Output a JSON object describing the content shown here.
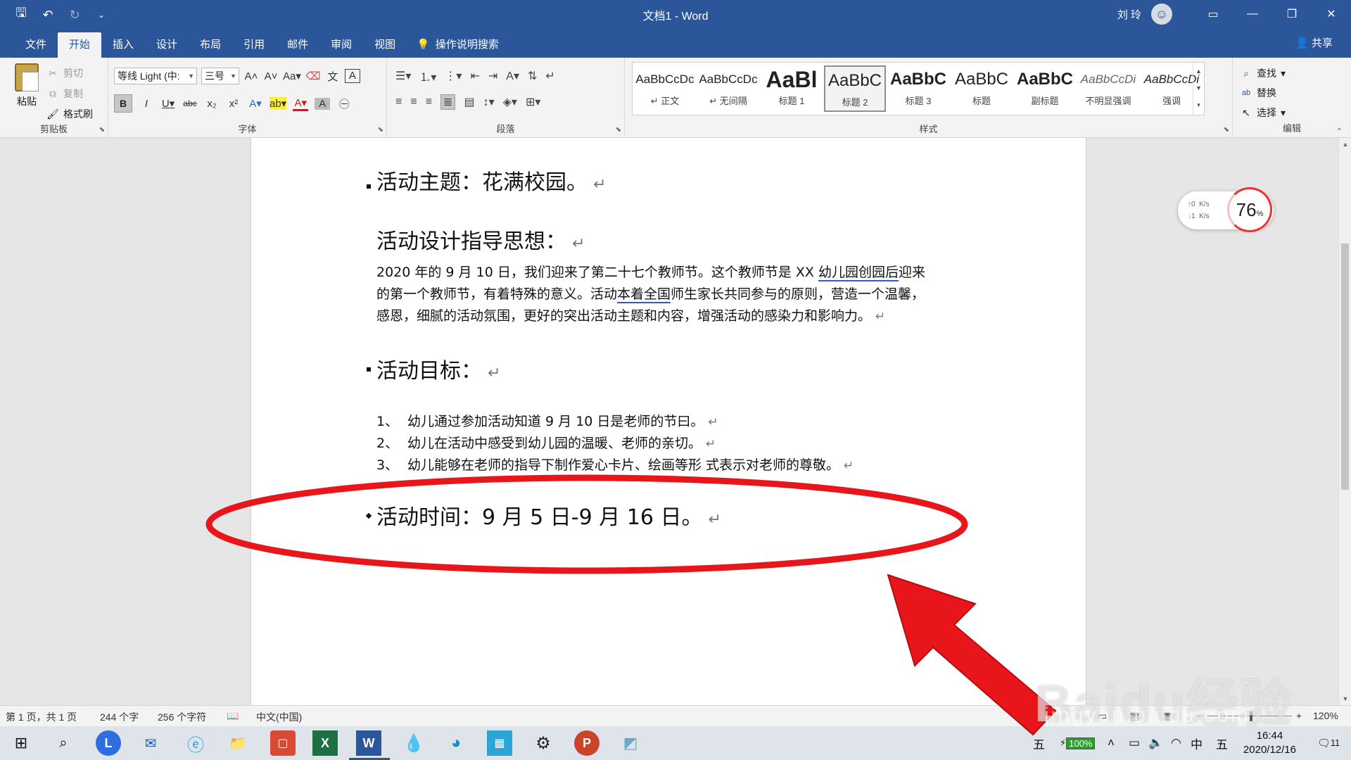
{
  "window": {
    "title": "文档1 - Word",
    "user": "刘 玲",
    "colors": {
      "accent": "#2b579a",
      "annotation": "#e8151b"
    }
  },
  "qat": {
    "save_icon": "save-icon",
    "undo_icon": "undo-icon",
    "redo_icon": "redo-icon"
  },
  "tabs": [
    {
      "label": "文件"
    },
    {
      "label": "开始"
    },
    {
      "label": "插入"
    },
    {
      "label": "设计"
    },
    {
      "label": "布局"
    },
    {
      "label": "引用"
    },
    {
      "label": "邮件"
    },
    {
      "label": "审阅"
    },
    {
      "label": "视图"
    }
  ],
  "tell_me": "操作说明搜索",
  "share": "共享",
  "clipboard": {
    "paste": "粘贴",
    "cut": "剪切",
    "copy": "复制",
    "format_painter": "格式刷",
    "group": "剪贴板"
  },
  "font": {
    "name": "等线 Light (中:",
    "size": "三号",
    "group": "字体"
  },
  "paragraph": {
    "group": "段落"
  },
  "styles": {
    "group": "样式",
    "items": [
      {
        "sample": "AaBbCcDc",
        "name": "↵ 正文"
      },
      {
        "sample": "AaBbCcDc",
        "name": "↵ 无间隔"
      },
      {
        "sample": "AaBl",
        "name": "标题 1"
      },
      {
        "sample": "AaBbC",
        "name": "标题 2"
      },
      {
        "sample": "AaBbC",
        "name": "标题 3"
      },
      {
        "sample": "AaBbC",
        "name": "标题"
      },
      {
        "sample": "AaBbC",
        "name": "副标题"
      },
      {
        "sample": "AaBbCcDi",
        "name": "不明显强调"
      },
      {
        "sample": "AaBbCcDi",
        "name": "强调"
      }
    ]
  },
  "editing": {
    "find": "查找",
    "replace": "替换",
    "select": "选择",
    "group": "编辑"
  },
  "document": {
    "theme": "活动主题：花满校园。",
    "guide_heading": "活动设计指导思想：",
    "guide_line1_a": "2020 年的 9 月 10 日，我们迎来了第二十七个教师节。这个教师节是 XX ",
    "guide_line1_b": "幼儿园创园后",
    "guide_line1_c": "迎来",
    "guide_line2_a": "的第一个教师节，有着特殊的意义。活动",
    "guide_line2_b": "本着全国",
    "guide_line2_c": "师生家长共同参与的原则，营造一个温馨，",
    "guide_line3": "感恩，细腻的活动氛围，更好的突出活动主题和内容，增强活动的感染力和影响力。",
    "goal_heading": "活动目标：",
    "goals": [
      {
        "num": "1、",
        "text": "幼儿通过参加活动知道 9 月 10 日是老师的节曰。"
      },
      {
        "num": "2、",
        "text": "幼儿在活动中感受到幼儿园的温暖、老师的亲切。"
      },
      {
        "num": "3、",
        "text": "幼儿能够在老师的指导下制作爱心卡片、绘画等形  式表示对老师的尊敬。"
      }
    ],
    "time": "活动时间：9 月 5 日-9 月 16 日。",
    "para_mark": "↵"
  },
  "net_widget": {
    "up_speed": "0",
    "down_speed": "1",
    "unit": "K/s",
    "percent": "76",
    "percent_sign": "%"
  },
  "status": {
    "page": "第 1 页，共 1 页",
    "words": "244 个字",
    "chars": "256 个字符",
    "language": "中文(中国)",
    "zoom": "120%"
  },
  "taskbar": {
    "ime1": "五",
    "battery": "100%",
    "ime_lang": "中",
    "ime2": "五",
    "time": "16:44",
    "date": "2020/12/16",
    "notifications": "11"
  },
  "watermark": {
    "text": "Baidu经验",
    "sub": "jingyan.baidu.com"
  }
}
